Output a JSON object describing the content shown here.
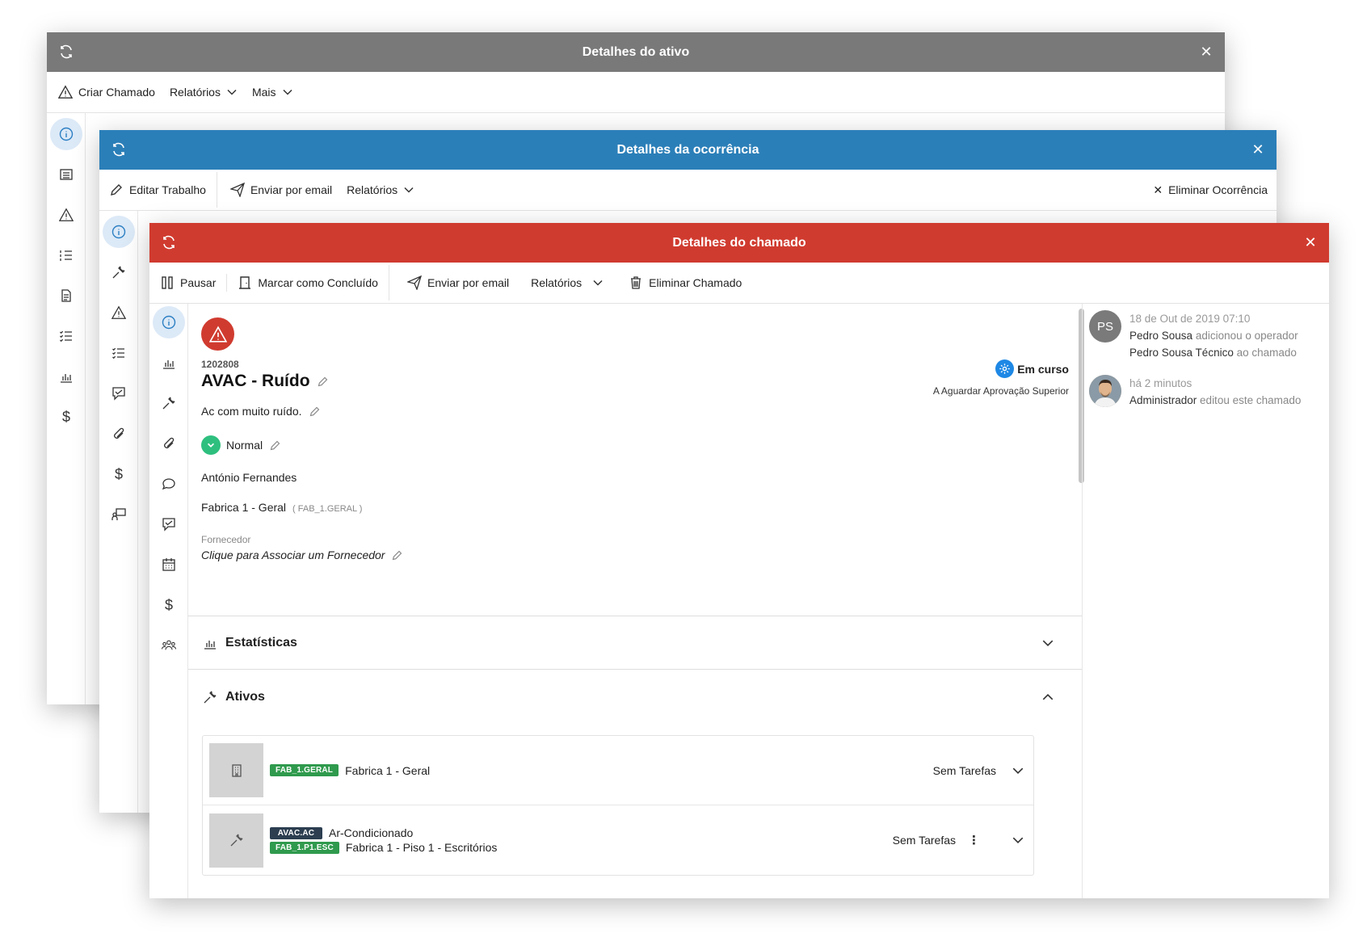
{
  "windows": {
    "asset": {
      "title": "Detalhes do ativo",
      "color": "#797979",
      "toolbar": {
        "create_ticket": "Criar Chamado",
        "reports": "Relatórios",
        "more": "Mais"
      }
    },
    "occurrence": {
      "title": "Detalhes da ocorrência",
      "color": "#2b7fb8",
      "toolbar": {
        "edit_work": "Editar Trabalho",
        "send_email": "Enviar por email",
        "reports": "Relatórios",
        "delete": "Eliminar Ocorrência"
      }
    },
    "ticket": {
      "title": "Detalhes do chamado",
      "color": "#d03b2f",
      "toolbar": {
        "pause": "Pausar",
        "mark_done": "Marcar como Concluído",
        "send_email": "Enviar por email",
        "reports": "Relatórios",
        "delete": "Eliminar Chamado"
      },
      "ticket_id": "1202808",
      "ticket_title": "AVAC - Ruído",
      "description": "Ac com muito ruído.",
      "priority": "Normal",
      "status": "Em curso",
      "substatus": "A Aguardar Aprovação Superior",
      "requester": "António Fernandes",
      "location": "Fabrica 1 - Geral",
      "location_code": "( FAB_1.GERAL )",
      "supplier_label": "Fornecedor",
      "supplier_value": "Clique para Associar um Fornecedor",
      "sections": {
        "statistics": "Estatísticas",
        "assets": "Ativos"
      },
      "assets": [
        {
          "tags": [
            {
              "code": "FAB_1.GERAL",
              "color": "#2f9a4d"
            }
          ],
          "names": [
            "Fabrica 1 - Geral"
          ],
          "tasks": "Sem Tarefas",
          "icon": "building-icon"
        },
        {
          "tags": [
            {
              "code": "AVAC.AC",
              "color": "#2c3e50"
            },
            {
              "code": "FAB_1.P1.ESC",
              "color": "#2f9a4d"
            }
          ],
          "names": [
            "Ar-Condicionado",
            "Fabrica 1 - Piso 1 - Escritórios"
          ],
          "tasks": "Sem Tarefas",
          "icon": "wrench-icon"
        }
      ],
      "activity": [
        {
          "avatar": "PS",
          "time": "18 de Out de 2019 07:10",
          "actor": "Pedro Sousa",
          "action": "adicionou o operador",
          "target": "Pedro Sousa Técnico",
          "suffix": "ao chamado"
        },
        {
          "avatar": "photo",
          "time": "há 2 minutos",
          "actor": "Administrador",
          "action": "editou este chamado"
        }
      ]
    }
  },
  "colors": {
    "active_nav": "#2b7fc3",
    "priority": "#2ebf7e",
    "status": "#1e88e5"
  }
}
